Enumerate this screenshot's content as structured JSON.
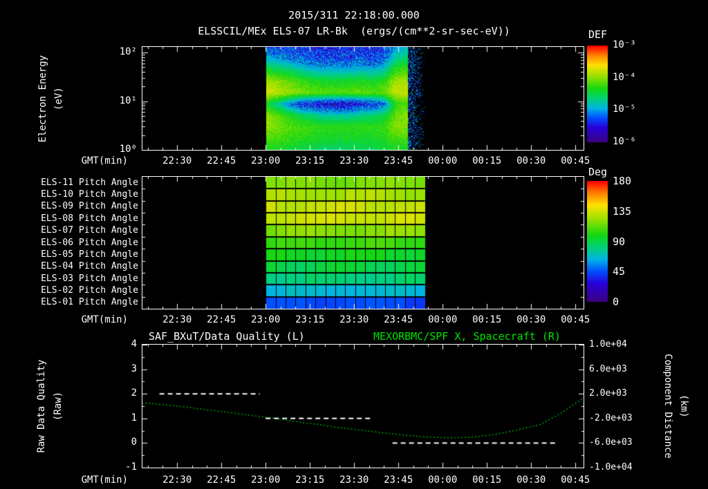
{
  "page": {
    "bg": "#000000",
    "fg": "#ffffff",
    "accent_green": "#00e600",
    "curve_green": "#00aa00",
    "title_datetime": "2015/311 22:18:00.000",
    "title_instrument": "ELSSCIL/MEx ELS-07 LR-Bk  (ergs/(cm**2-sr-sec-eV))"
  },
  "time_axis": {
    "label": "GMT(min)",
    "start": "22:18",
    "end": "00:48",
    "ticks": [
      "22:30",
      "22:45",
      "23:00",
      "23:15",
      "23:30",
      "23:45",
      "00:00",
      "00:15",
      "00:30",
      "00:45"
    ]
  },
  "chart_data": [
    {
      "name": "electron-energy-spectrogram",
      "type": "heatmap",
      "ylabel_line1": "Electron Energy",
      "ylabel_line2": "(eV)",
      "y_scale": "log",
      "y_ticks": [
        "10²",
        "10¹",
        "10⁰"
      ],
      "y_range_ev": [
        1,
        130
      ],
      "colorbar": {
        "title": "DEF",
        "ticks": [
          "10⁻³",
          "10⁻⁴",
          "10⁻⁵",
          "10⁻⁶"
        ],
        "log_range": [
          -6,
          -3
        ]
      },
      "data_start": "23:00",
      "data_end": "23:48",
      "speckle_end": "23:54",
      "grid_log10_def": {
        "time_cols": 13,
        "energy_rows_log10ev_top_to_bottom": [
          2.06,
          1.8,
          1.56,
          1.32,
          1.08,
          0.85,
          0.61,
          0.38,
          0.15,
          0.0
        ],
        "values": [
          [
            -5.2,
            -5.3,
            -5.35,
            -5.4,
            -5.45,
            -5.5,
            -5.5,
            -5.5,
            -5.45,
            -5.5,
            -5.4,
            -5.0,
            -4.9
          ],
          [
            -4.9,
            -5.0,
            -5.1,
            -5.2,
            -5.25,
            -5.3,
            -5.3,
            -5.3,
            -5.25,
            -5.3,
            -5.2,
            -4.7,
            -4.6
          ],
          [
            -4.4,
            -4.5,
            -4.6,
            -4.75,
            -4.85,
            -4.9,
            -4.9,
            -4.9,
            -4.85,
            -4.9,
            -4.8,
            -4.3,
            -4.2
          ],
          [
            -3.9,
            -4.0,
            -4.1,
            -4.25,
            -4.35,
            -4.4,
            -4.4,
            -4.4,
            -4.35,
            -4.4,
            -4.3,
            -3.9,
            -3.9
          ],
          [
            -3.75,
            -3.85,
            -3.95,
            -4.05,
            -4.1,
            -4.15,
            -4.15,
            -4.15,
            -4.1,
            -4.15,
            -4.1,
            -3.8,
            -3.8
          ],
          [
            -4.4,
            -4.7,
            -5.1,
            -5.4,
            -5.5,
            -5.6,
            -5.6,
            -5.6,
            -5.5,
            -5.4,
            -5.2,
            -4.3,
            -4.2
          ],
          [
            -4.0,
            -4.15,
            -4.35,
            -4.55,
            -4.65,
            -4.75,
            -4.75,
            -4.75,
            -4.65,
            -4.6,
            -4.5,
            -4.1,
            -4.0
          ],
          [
            -3.95,
            -4.05,
            -4.15,
            -4.2,
            -4.25,
            -4.3,
            -4.3,
            -4.3,
            -4.3,
            -4.3,
            -4.25,
            -4.0,
            -4.0
          ],
          [
            -4.15,
            -4.2,
            -4.25,
            -4.3,
            -4.35,
            -4.4,
            -4.4,
            -4.4,
            -4.4,
            -4.4,
            -4.35,
            -4.2,
            -4.2
          ],
          [
            -4.35,
            -4.4,
            -4.45,
            -4.5,
            -4.55,
            -4.6,
            -4.6,
            -4.6,
            -4.55,
            -4.55,
            -4.5,
            -4.4,
            -4.4
          ]
        ]
      }
    },
    {
      "name": "pitch-angle-panel",
      "type": "heatmap",
      "data_start": "23:00",
      "data_end": "23:54",
      "grid_cols": 16,
      "colorbar": {
        "title": "Deg",
        "ticks": [
          "180",
          "135",
          "90",
          "45",
          "0"
        ],
        "range": [
          0,
          180
        ]
      },
      "rows": [
        {
          "label": "ELS-11 Pitch Angle",
          "mean_deg": 118
        },
        {
          "label": "ELS-10 Pitch Angle",
          "mean_deg": 126
        },
        {
          "label": "ELS-09 Pitch Angle",
          "mean_deg": 132
        },
        {
          "label": "ELS-08 Pitch Angle",
          "mean_deg": 133
        },
        {
          "label": "ELS-07 Pitch Angle",
          "mean_deg": 120
        },
        {
          "label": "ELS-06 Pitch Angle",
          "mean_deg": 105
        },
        {
          "label": "ELS-05 Pitch Angle",
          "mean_deg": 97
        },
        {
          "label": "ELS-04 Pitch Angle",
          "mean_deg": 90
        },
        {
          "label": "ELS-03 Pitch Angle",
          "mean_deg": 81
        },
        {
          "label": "ELS-02 Pitch Angle",
          "mean_deg": 66
        },
        {
          "label": "ELS-01 Pitch Angle",
          "mean_deg": 44
        }
      ]
    },
    {
      "name": "quality-and-distance",
      "type": "line",
      "title_left": "SAF_BXuT/Data Quality (L)",
      "title_right": "MEXORBMC/SPF X, Spacecraft (R)",
      "left_axis": {
        "label_line1": "Raw Data Quality",
        "label_line2": "(Raw)",
        "ticks": [
          4,
          3,
          2,
          1,
          0,
          -1
        ],
        "range": [
          -1,
          4
        ]
      },
      "right_axis": {
        "label_line1": "Component Distance",
        "label_line2": "(km)",
        "ticks": [
          "1.0e+04",
          "6.0e+03",
          "2.0e+03",
          "-2.0e+03",
          "-6.0e+03",
          "-1.0e+04"
        ],
        "range": [
          -10000,
          10000
        ]
      },
      "quality_segments": [
        {
          "start": "22:24",
          "end": "22:58",
          "value": 2
        },
        {
          "start": "23:00",
          "end": "23:36",
          "value": 1
        },
        {
          "start": "23:43",
          "end": "00:39",
          "value": 0
        }
      ],
      "spacecraft_x_km": {
        "times": [
          "22:18",
          "22:25",
          "22:33",
          "22:40",
          "22:48",
          "22:55",
          "23:03",
          "23:10",
          "23:18",
          "23:25",
          "23:33",
          "23:40",
          "23:48",
          "23:55",
          "00:03",
          "00:10",
          "00:18",
          "00:25",
          "00:33",
          "00:40",
          "00:48"
        ],
        "values": [
          600,
          250,
          -150,
          -600,
          -1050,
          -1500,
          -2000,
          -2500,
          -3000,
          -3500,
          -3950,
          -4350,
          -4750,
          -5050,
          -5150,
          -5050,
          -4600,
          -3900,
          -3000,
          -1200,
          1400
        ]
      }
    }
  ]
}
